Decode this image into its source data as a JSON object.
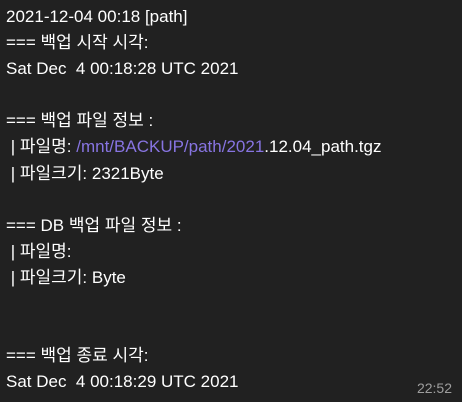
{
  "message": {
    "lines": [
      "2021-12-04 00:18 [path]",
      "=== 백업 시작 시각:",
      "Sat Dec  4 00:18:28 UTC 2021",
      "",
      "=== 백업 파일 정보 :",
      "",
      " | 파일크기: 2321Byte",
      "",
      "=== DB 백업 파일 정보 :",
      " | 파일명:",
      " | 파일크기: Byte",
      "",
      "",
      "=== 백업 종료 시각:",
      "Sat Dec  4 00:18:29 UTC 2021"
    ],
    "file_line": {
      "prefix": " | 파일명: ",
      "link": "/mnt/BACKUP/path/2021",
      "suffix": ".12.04_path.tgz"
    },
    "time": "22:52"
  },
  "colors": {
    "background": "#212121",
    "text": "#ffffff",
    "link": "#8774e1",
    "time": "#9e9e9e"
  }
}
